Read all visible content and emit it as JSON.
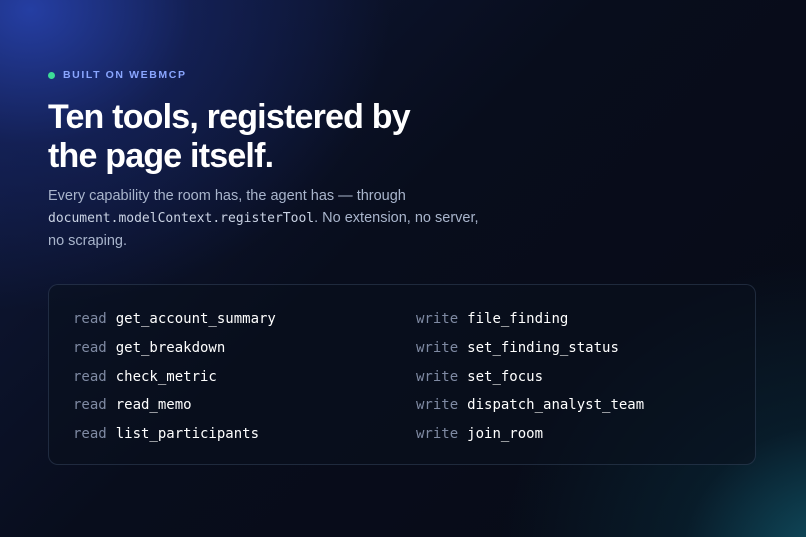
{
  "eyebrow": {
    "text": "BUILT ON WEBMCP",
    "dot_color": "#3ddc97"
  },
  "title": {
    "line1": "Ten tools, registered by",
    "line2": "the page itself."
  },
  "subtitle": {
    "before_code": "Every capability the room has, the agent has — through",
    "code": "document.modelContext.registerTool",
    "after_code": ". No extension, no server, no scraping."
  },
  "tools": {
    "read": [
      {
        "type": "read",
        "name": "get_account_summary"
      },
      {
        "type": "read",
        "name": "get_breakdown"
      },
      {
        "type": "read",
        "name": "check_metric"
      },
      {
        "type": "read",
        "name": "read_memo"
      },
      {
        "type": "read",
        "name": "list_participants"
      }
    ],
    "write": [
      {
        "type": "write",
        "name": "file_finding"
      },
      {
        "type": "write",
        "name": "set_finding_status"
      },
      {
        "type": "write",
        "name": "set_focus"
      },
      {
        "type": "write",
        "name": "dispatch_analyst_team"
      },
      {
        "type": "write",
        "name": "join_room"
      }
    ]
  },
  "colors": {
    "accent_blue": "#8aa6ff",
    "accent_green": "#3ddc97",
    "background": "#070b16"
  }
}
